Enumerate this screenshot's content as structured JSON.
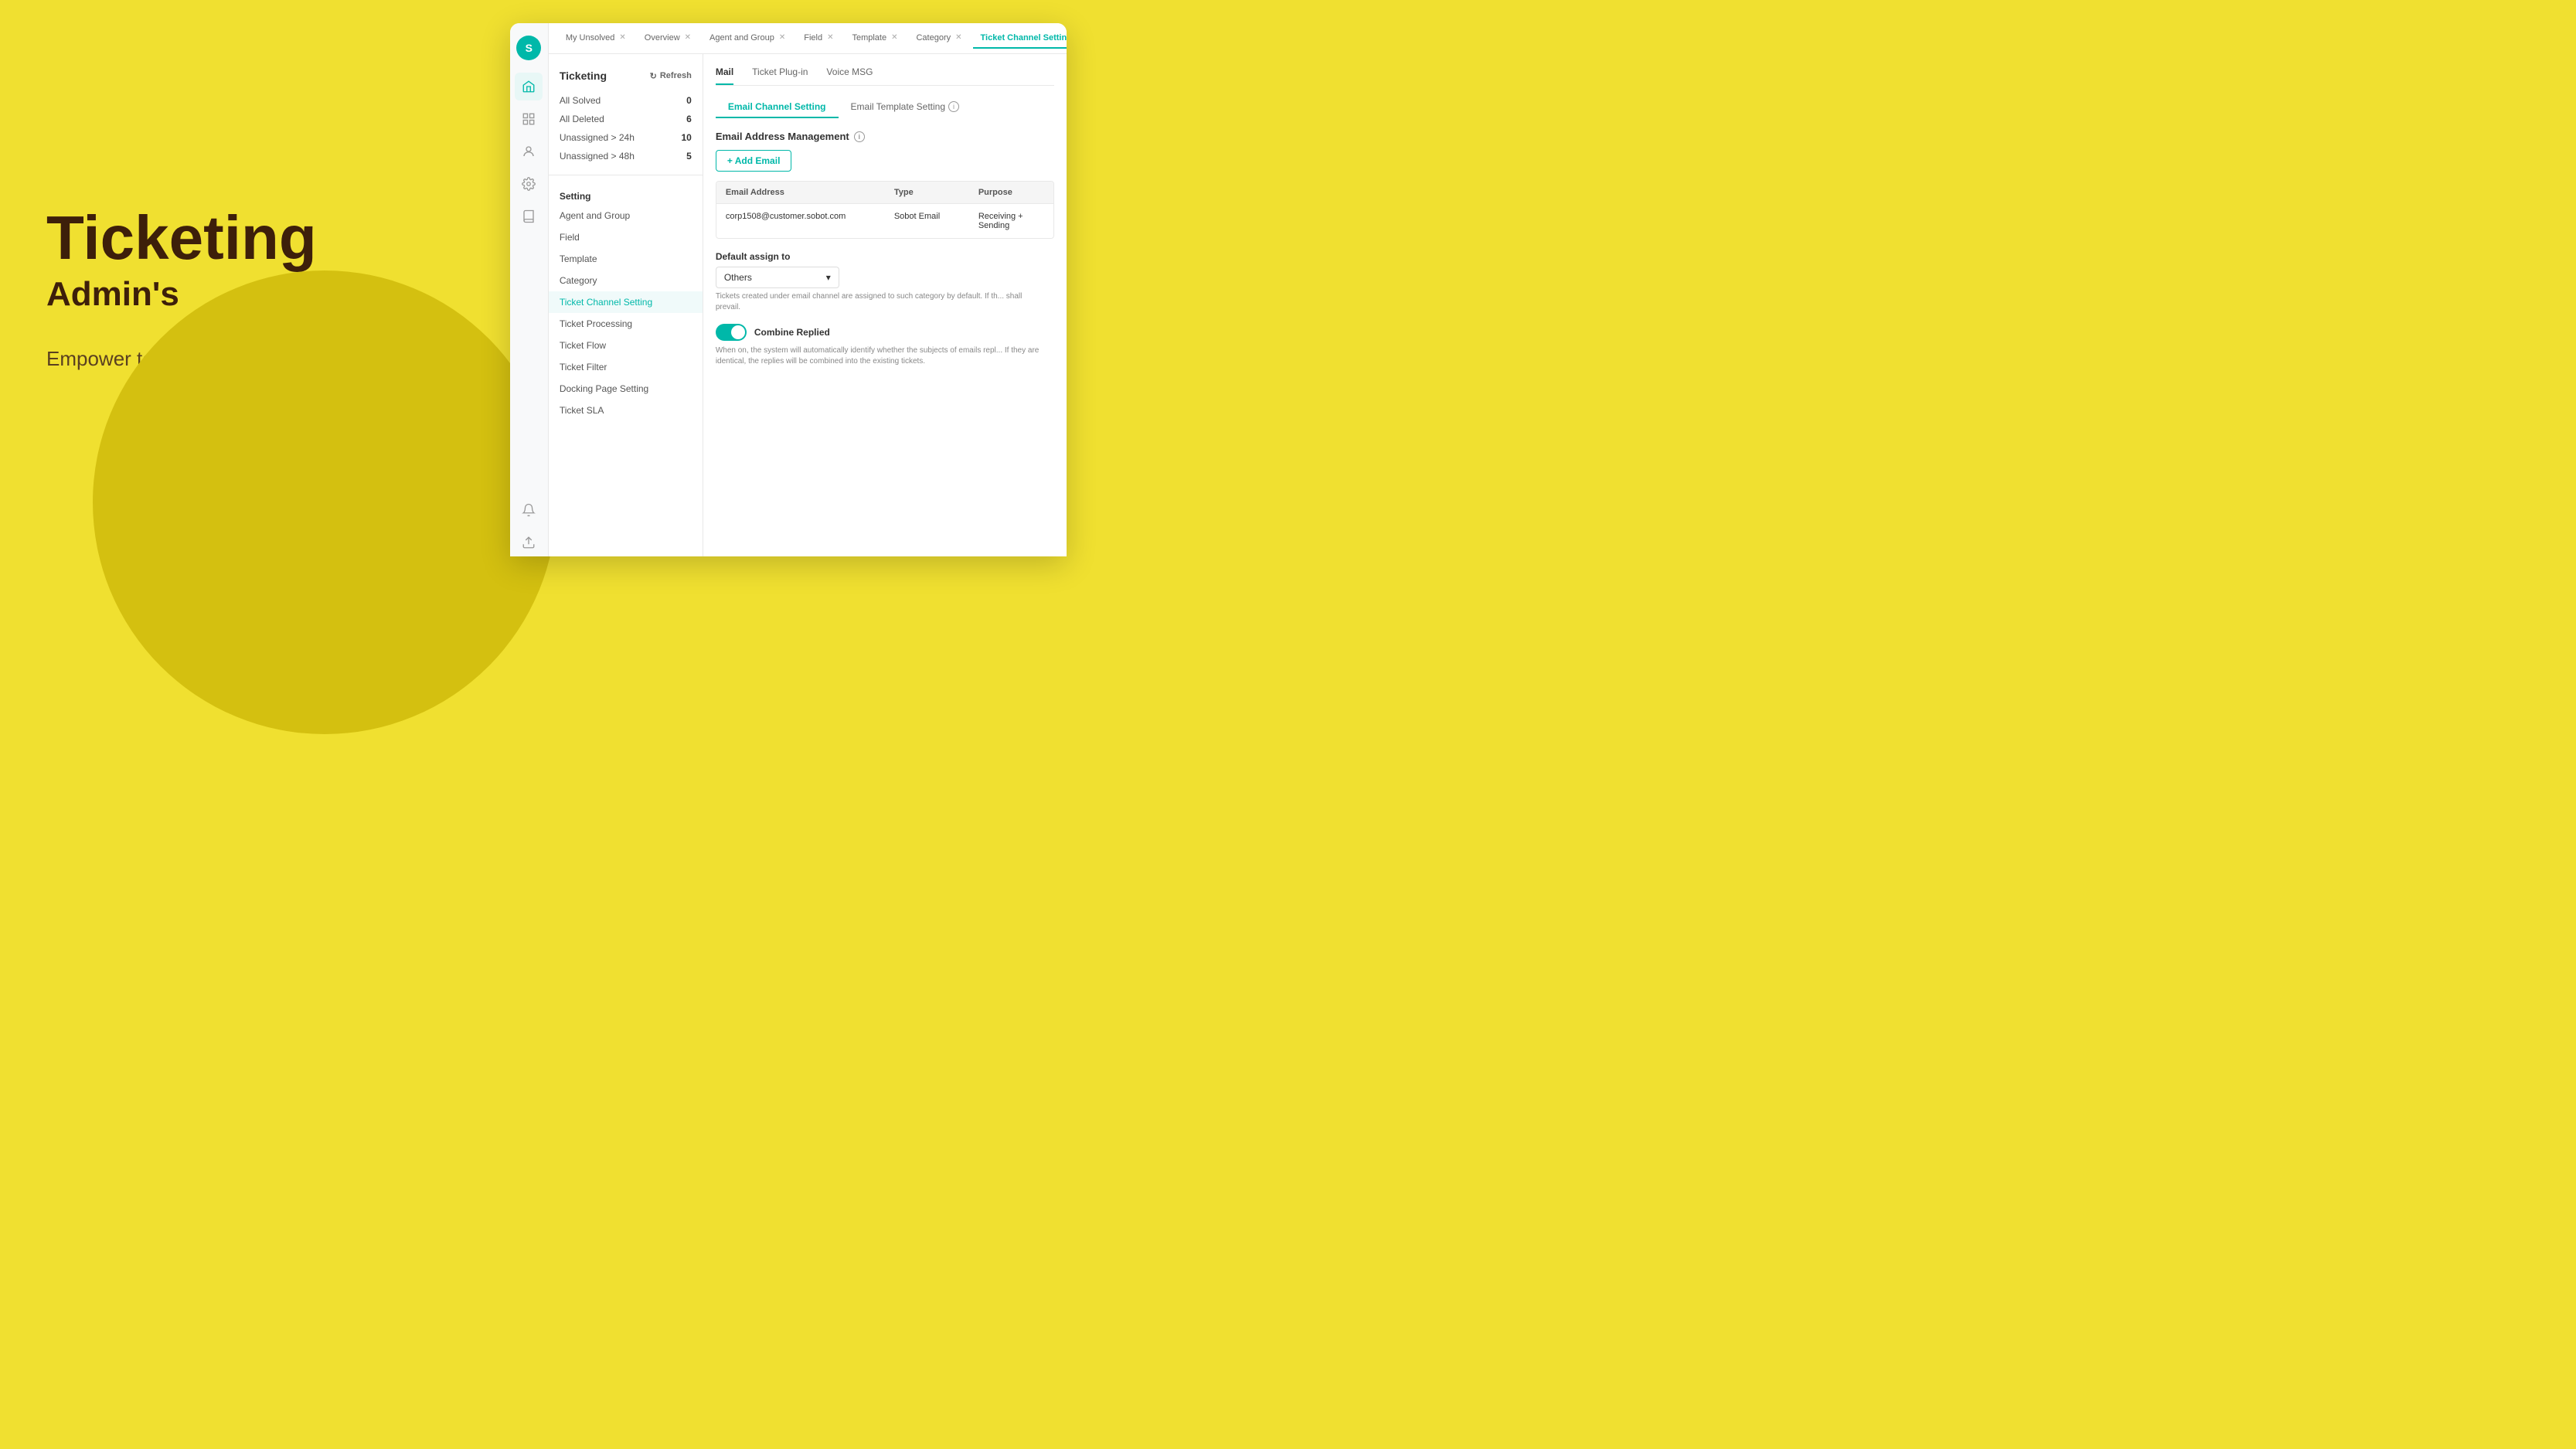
{
  "left": {
    "title": "Ticketing",
    "subtitle": "Admin's",
    "description": "Empower teams with streamlined workflows."
  },
  "app": {
    "sidebar_avatar": "S",
    "tabs": [
      {
        "label": "My Unsolved",
        "active": false
      },
      {
        "label": "Overview",
        "active": false
      },
      {
        "label": "Agent and Group",
        "active": false
      },
      {
        "label": "Field",
        "active": false
      },
      {
        "label": "Template",
        "active": false
      },
      {
        "label": "Category",
        "active": false
      },
      {
        "label": "Ticket Channel Setting",
        "active": true
      }
    ],
    "nav": {
      "title": "Ticketing",
      "refresh": "Refresh",
      "stats": [
        {
          "label": "All Solved",
          "count": "0"
        },
        {
          "label": "All Deleted",
          "count": "6"
        },
        {
          "label": "Unassigned > 24h",
          "count": "10"
        },
        {
          "label": "Unassigned > 48h",
          "count": "5"
        }
      ],
      "section_title": "Setting",
      "items": [
        {
          "label": "Agent and Group"
        },
        {
          "label": "Field"
        },
        {
          "label": "Template"
        },
        {
          "label": "Category"
        },
        {
          "label": "Ticket Channel Setting",
          "active": true
        },
        {
          "label": "Ticket Processing"
        },
        {
          "label": "Ticket Flow"
        },
        {
          "label": "Ticket Filter"
        },
        {
          "label": "Docking Page Setting"
        },
        {
          "label": "Ticket SLA"
        }
      ]
    },
    "main": {
      "sub_nav": [
        {
          "label": "Mail",
          "active": true
        },
        {
          "label": "Ticket Plug-in",
          "active": false
        },
        {
          "label": "Voice MSG",
          "active": false
        }
      ],
      "section_tabs": [
        {
          "label": "Email Channel Setting",
          "active": true
        },
        {
          "label": "Email Template Setting",
          "active": false,
          "has_info": true
        }
      ],
      "email_management_title": "Email Address Management",
      "add_email_btn": "+ Add Email",
      "table": {
        "headers": [
          "Email Address",
          "Type",
          "Purpose"
        ],
        "rows": [
          {
            "email": "corp1508@customer.sobot.com",
            "type": "Sobot Email",
            "purpose": "Receiving + Sending"
          }
        ]
      },
      "default_assign": {
        "label": "Default assign to",
        "value": "Others"
      },
      "assign_desc": "Tickets created under email channel are assigned to such category by default. If th... shall prevail.",
      "combine_replied": {
        "label": "Combine Replied",
        "enabled": true,
        "desc": "When on, the system will automatically identify whether the subjects of emails repl... If they are identical, the replies will be combined into the existing tickets."
      }
    }
  }
}
